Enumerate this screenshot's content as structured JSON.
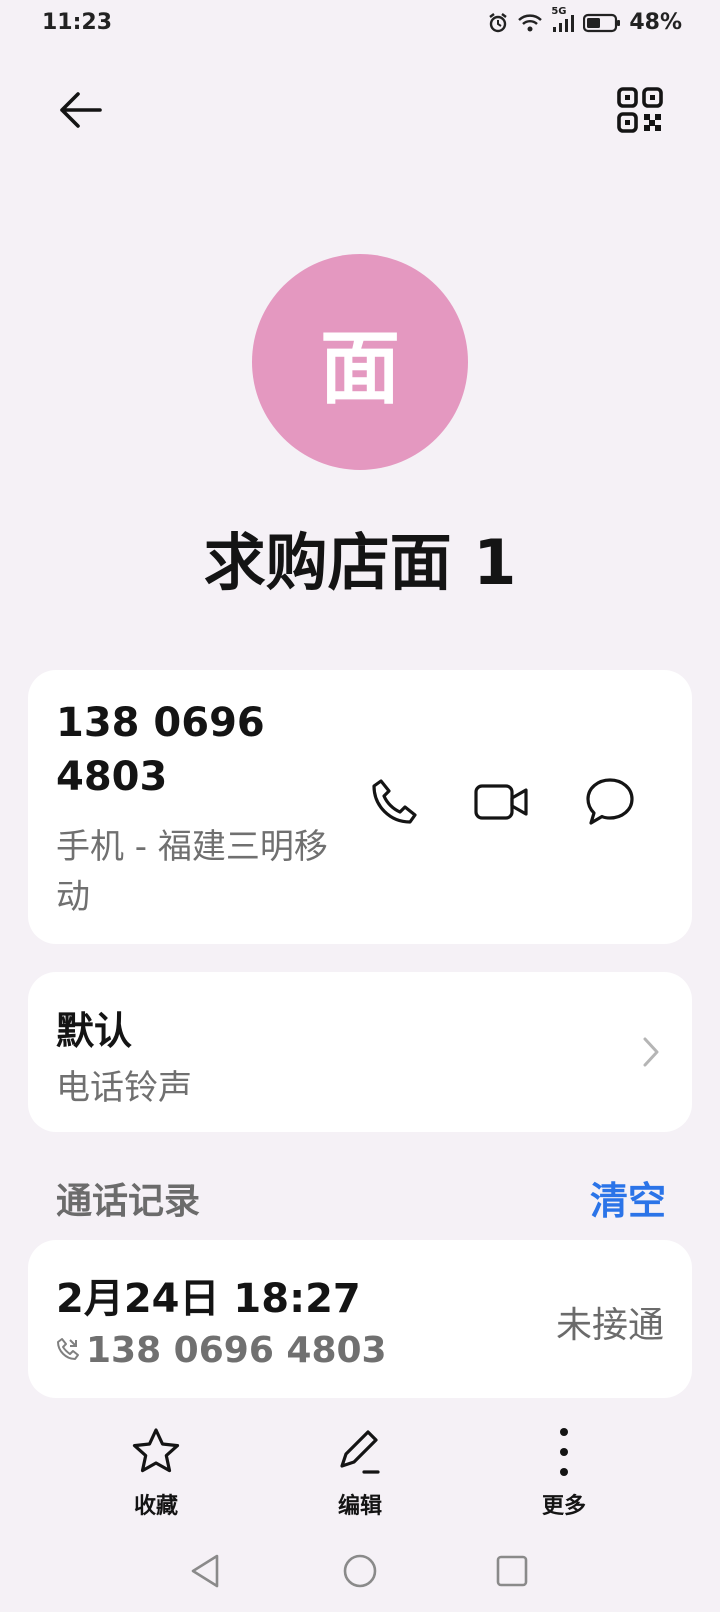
{
  "status_bar": {
    "time": "11:23",
    "network": "5G",
    "battery": "48%"
  },
  "header": {
    "back_icon": "arrow-left-icon",
    "qr_icon": "qr-code-icon"
  },
  "contact": {
    "avatar_char": "面",
    "avatar_color": "#e498c0",
    "name": "求购店面 1"
  },
  "phone": {
    "number": "138 0696 4803",
    "label": "手机 - 福建三明移动",
    "actions": [
      "phone-icon",
      "video-call-icon",
      "message-icon"
    ]
  },
  "ringtone": {
    "value": "默认",
    "label": "电话铃声"
  },
  "call_log": {
    "title": "通话记录",
    "clear_label": "清空",
    "clear_color": "#2b74e8",
    "entries": [
      {
        "datetime": "2月24日 18:27",
        "number": "138 0696 4803",
        "status": "未接通"
      }
    ]
  },
  "toolbar": {
    "favorite_label": "收藏",
    "edit_label": "编辑",
    "more_label": "更多"
  }
}
